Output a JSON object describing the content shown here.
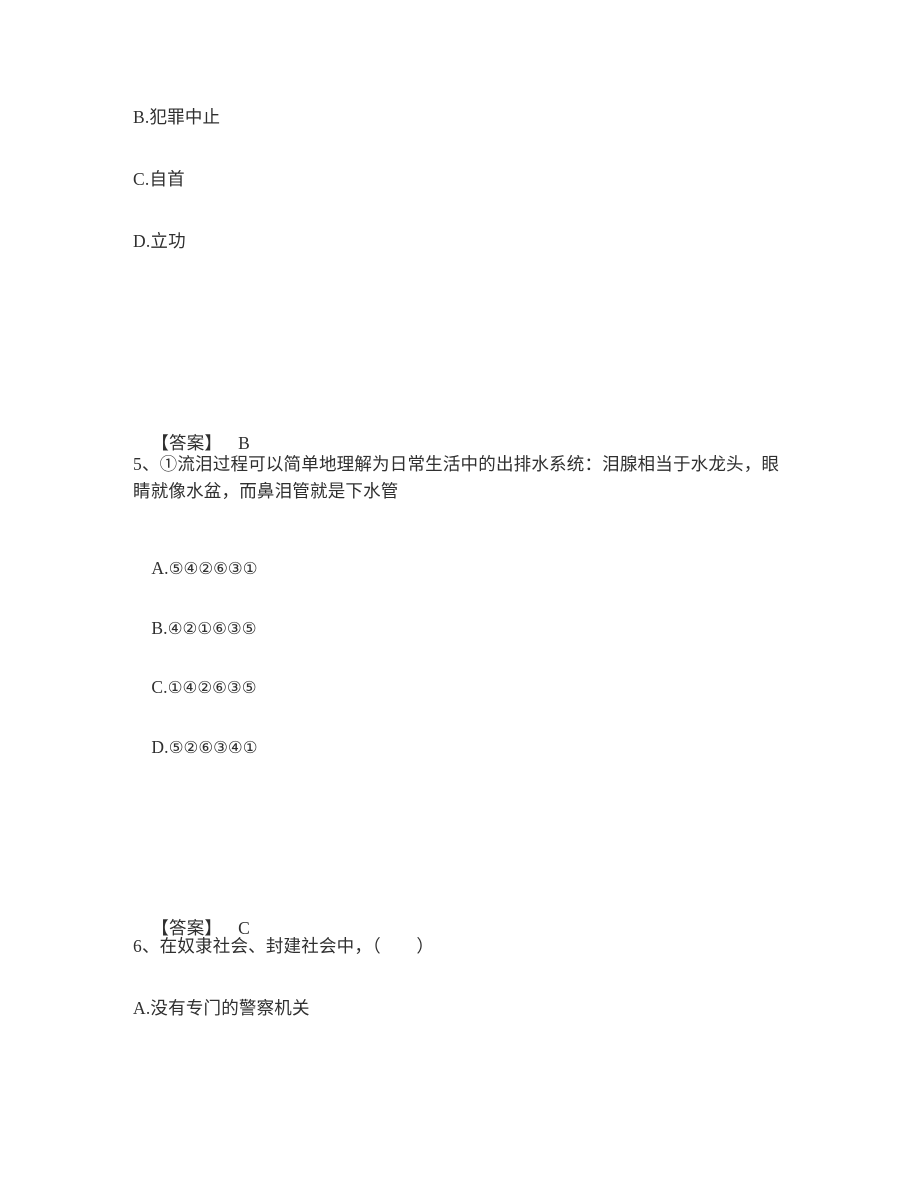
{
  "document": {
    "page_background": "#ffffff",
    "text_color": "#2f2f2f"
  },
  "question_4_tail": {
    "options": [
      {
        "key": "B",
        "text": "B.犯罪中止"
      },
      {
        "key": "C",
        "text": "C.自首"
      },
      {
        "key": "D",
        "text": "D.立功"
      }
    ],
    "answer_label": "【答案】",
    "answer_value": "B"
  },
  "question_5": {
    "number": "5、",
    "stem": "5、①流泪过程可以简单地理解为日常生活中的出排水系统：泪腺相当于水龙头，眼睛就像水盆，而鼻泪管就是下水管",
    "options": [
      {
        "key": "A",
        "letter": "A.",
        "sequence": "⑤④②⑥③①"
      },
      {
        "key": "B",
        "letter": "B.",
        "sequence": "④②①⑥③⑤"
      },
      {
        "key": "C",
        "letter": "C.",
        "sequence": "①④②⑥③⑤"
      },
      {
        "key": "D",
        "letter": "D.",
        "sequence": "⑤②⑥③④①"
      }
    ],
    "answer_label": "【答案】",
    "answer_value": "C"
  },
  "question_6": {
    "stem": "6、在奴隶社会、封建社会中，（　　）",
    "options": [
      {
        "key": "A",
        "text": "A.没有专门的警察机关"
      }
    ]
  }
}
